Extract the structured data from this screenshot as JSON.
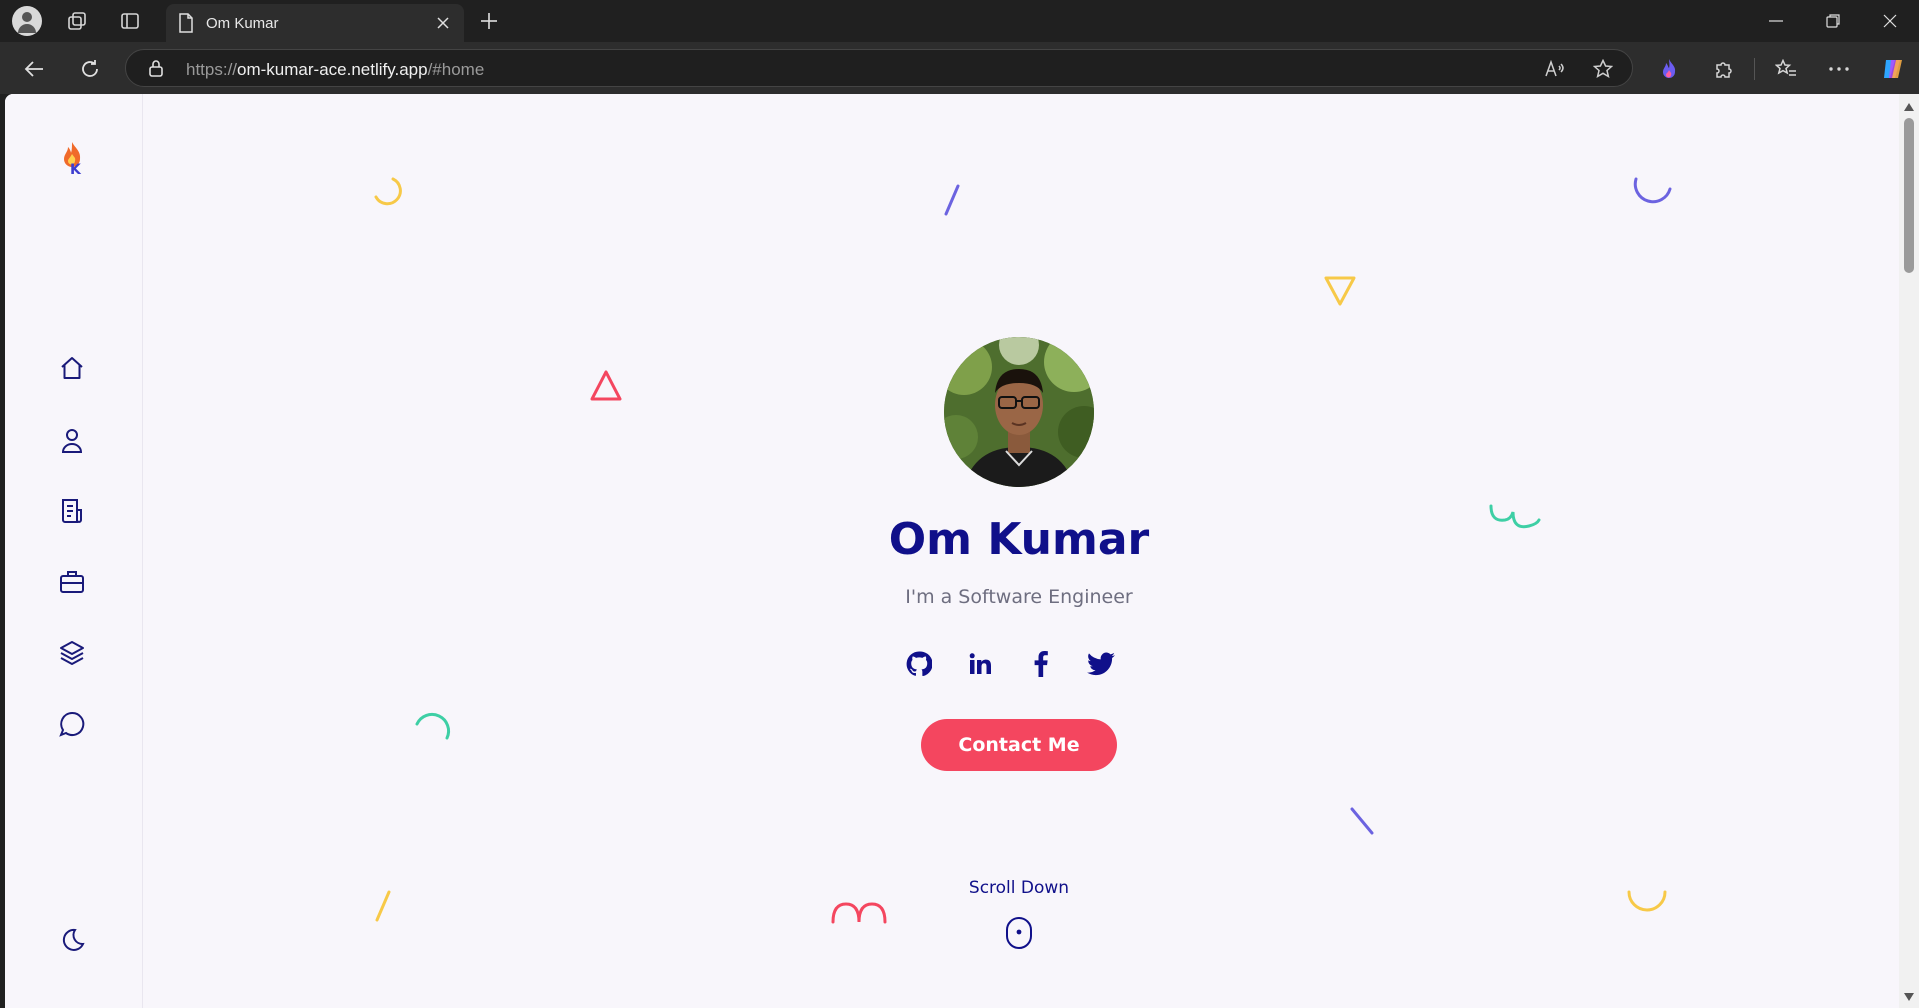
{
  "browser": {
    "tab_title": "Om Kumar",
    "url_scheme": "https://",
    "url_host": "om-kumar-ace.netlify.app",
    "url_path": "/#home"
  },
  "sidebar": {
    "items": [
      {
        "name": "home",
        "icon": "home-icon"
      },
      {
        "name": "about",
        "icon": "user-icon"
      },
      {
        "name": "resume",
        "icon": "document-icon"
      },
      {
        "name": "portfolio",
        "icon": "briefcase-icon"
      },
      {
        "name": "services",
        "icon": "layers-icon"
      },
      {
        "name": "contact",
        "icon": "chat-icon"
      }
    ],
    "theme_toggle_icon": "moon-icon"
  },
  "hero": {
    "name": "Om Kumar",
    "subtitle": "I'm a Software Engineer",
    "social": [
      "github-icon",
      "linkedin-icon",
      "facebook-icon",
      "twitter-icon"
    ],
    "contact_label": "Contact Me",
    "scroll_label": "Scroll Down"
  },
  "colors": {
    "primary": "#10108a",
    "accent": "#f4465f",
    "yellow": "#f7c948",
    "purple": "#6c63e0",
    "teal": "#3ecfa5",
    "background": "#f8f6fb"
  }
}
